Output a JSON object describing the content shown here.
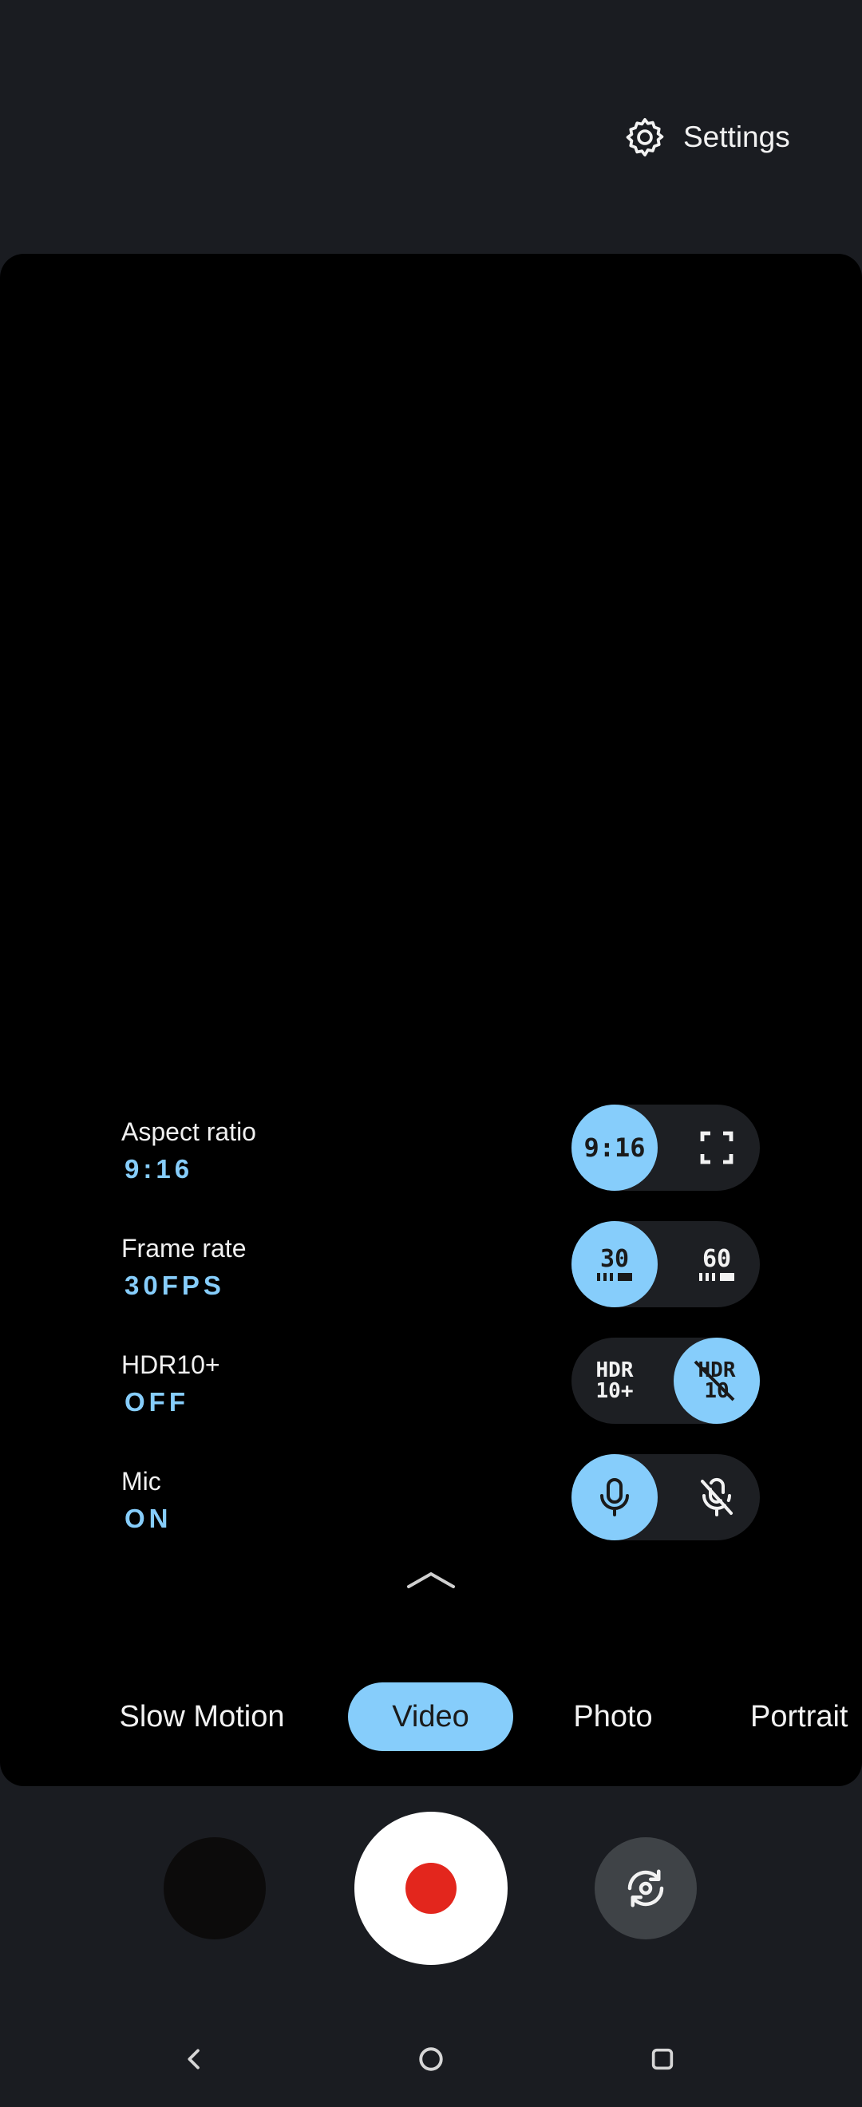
{
  "header": {
    "settings_label": "Settings"
  },
  "quick_settings": [
    {
      "title": "Aspect ratio",
      "value": "9:16",
      "options": [
        "9:16",
        "full-screen"
      ],
      "selected": 0
    },
    {
      "title": "Frame rate",
      "value": "30FPS",
      "options": [
        "30",
        "60"
      ],
      "selected": 0
    },
    {
      "title": "HDR10+",
      "value": "OFF",
      "options": [
        "HDR 10+",
        "HDR off"
      ],
      "selected": 1
    },
    {
      "title": "Mic",
      "value": "ON",
      "options": [
        "mic-on",
        "mic-off"
      ],
      "selected": 0
    }
  ],
  "chips": {
    "aspect_916": "9:16",
    "fps30": "30",
    "fps60": "60",
    "hdr_line1": "HDR",
    "hdr_line2": "10+",
    "hdroff_line1": "HDR",
    "hdroff_line2": "10"
  },
  "modes": [
    "Slow Motion",
    "Video",
    "Photo",
    "Portrait"
  ],
  "active_mode": "Video",
  "colors": {
    "accent": "#86cdfb",
    "record": "#e3261d",
    "background": "#1a1c21",
    "viewfinder": "#000000"
  },
  "icons": [
    "gear-icon",
    "fullscreen-icon",
    "microphone-icon",
    "mic-off-icon",
    "chevron-up-icon",
    "camera-flip-icon",
    "back-icon",
    "home-icon",
    "recents-icon"
  ]
}
